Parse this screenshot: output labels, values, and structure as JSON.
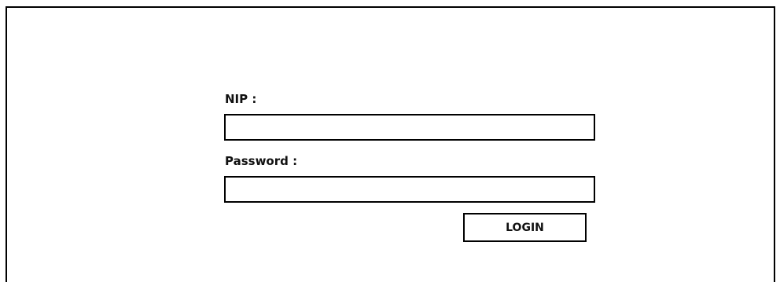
{
  "login_form": {
    "nip_label": "NIP :",
    "nip_value": "",
    "password_label": "Password :",
    "password_value": "",
    "login_button_label": "LOGIN"
  },
  "colors": {
    "border": "#000000",
    "background": "#ffffff",
    "text": "#111111"
  }
}
